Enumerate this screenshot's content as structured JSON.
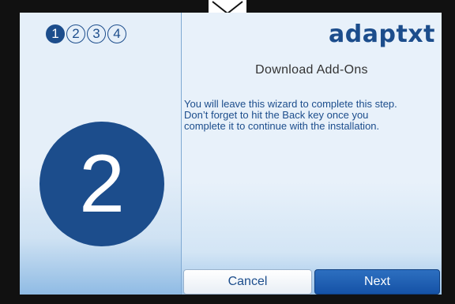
{
  "steps": [
    "1",
    "2",
    "3",
    "4"
  ],
  "active_step": 1,
  "current_step_large": "2",
  "logo": "adaptxt",
  "title": "Download Add-Ons",
  "message_lines": [
    "You will leave this wizard to complete this step.",
    "Don’t forget to hit the Back key once you",
    "complete it to continue with the installation."
  ],
  "buttons": {
    "cancel": "Cancel",
    "next": "Next"
  },
  "colors": {
    "accent": "#1c4d8c",
    "next_button": "#1a5bb0",
    "background": "#e3eef9"
  }
}
